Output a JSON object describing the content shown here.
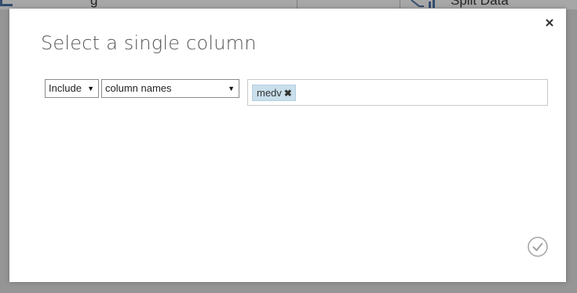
{
  "background": {
    "left_module_label": "g",
    "right_module_label": "Split Data"
  },
  "dialog": {
    "title": "Select a single column",
    "close_icon": "close-icon",
    "confirm_icon": "checkmark-icon"
  },
  "filter": {
    "mode_value": "Include",
    "by_value": "column names",
    "dropdown_icon": "dropdown-arrow-icon"
  },
  "selected_columns": [
    {
      "name": "medv",
      "remove_icon": "remove-tag-icon"
    }
  ],
  "colors": {
    "tag_background": "#c9dfec",
    "title_text": "#555555",
    "overlay": "#000000"
  }
}
